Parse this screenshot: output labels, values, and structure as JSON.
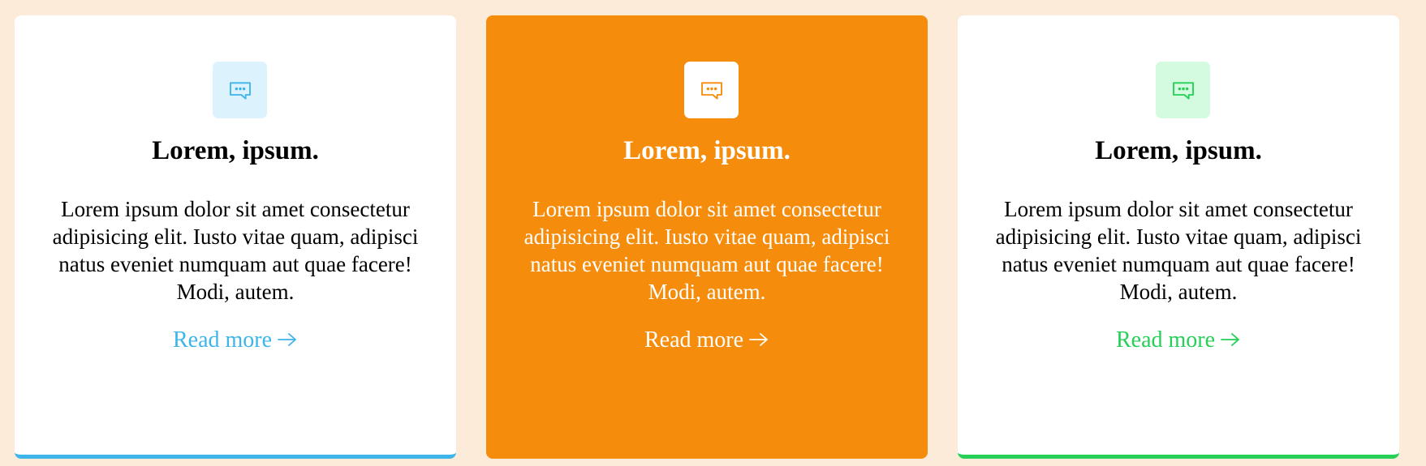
{
  "cards": [
    {
      "title": "Lorem, ipsum.",
      "text": "Lorem ipsum dolor sit amet consectetur adipisicing elit. Iusto vitae quam, adipisci natus eveniet numquam aut quae facere! Modi, autem.",
      "link": "Read more",
      "icon": "chat-bubble-icon",
      "accent": "#3db4ea"
    },
    {
      "title": "Lorem, ipsum.",
      "text": "Lorem ipsum dolor sit amet consectetur adipisicing elit. Iusto vitae quam, adipisci natus eveniet numquam aut quae facere! Modi, autem.",
      "link": "Read more",
      "icon": "chat-bubble-icon",
      "accent": "#f68c0b"
    },
    {
      "title": "Lorem, ipsum.",
      "text": "Lorem ipsum dolor sit amet consectetur adipisicing elit. Iusto vitae quam, adipisci natus eveniet numquam aut quae facere! Modi, autem.",
      "link": "Read more",
      "icon": "chat-bubble-icon",
      "accent": "#25cf58"
    }
  ],
  "colors": {
    "page_background": "#fbebd8",
    "card_background": "#ffffff"
  }
}
